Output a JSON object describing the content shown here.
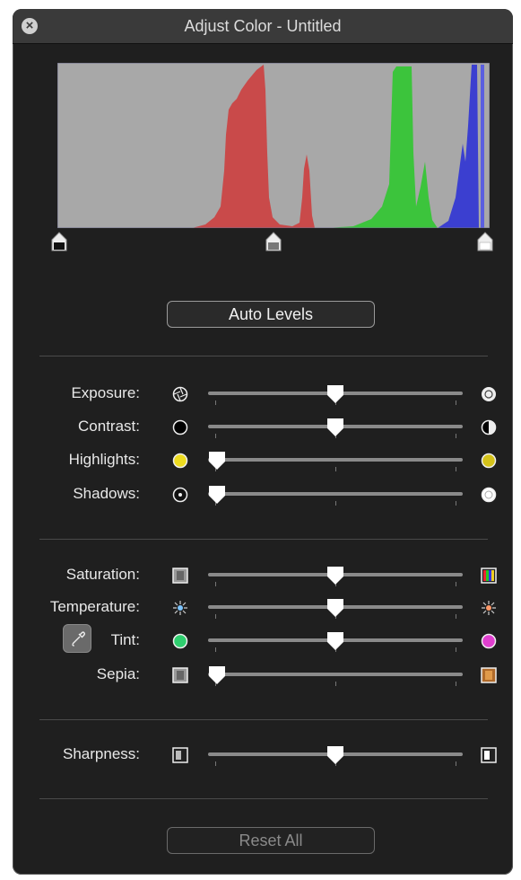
{
  "window": {
    "title": "Adjust Color - Untitled"
  },
  "colors": {
    "panel_bg": "#1f1f1f",
    "histogram_bg": "#a8a8a8",
    "red": "#c94a4a",
    "green": "#3cc43c",
    "blue": "#3b3fd0",
    "track": "#8a8a8a"
  },
  "histogram": {
    "black_point": 0,
    "gamma_point": 0.5,
    "white_point": 1
  },
  "auto_levels": {
    "label": "Auto Levels"
  },
  "sliders": {
    "exposure": {
      "label": "Exposure:",
      "value": 0.5,
      "min_icon": "aperture-icon",
      "max_icon": "aperture-bright-icon"
    },
    "contrast": {
      "label": "Contrast:",
      "value": 0.5,
      "min_icon": "circle-dark-icon",
      "max_icon": "half-circle-icon"
    },
    "highlights": {
      "label": "Highlights:",
      "value": 0.0,
      "min_icon": "yellow-circle-icon",
      "max_icon": "yellow-circle-icon"
    },
    "shadows": {
      "label": "Shadows:",
      "value": 0.0,
      "min_icon": "dot-circle-icon",
      "max_icon": "white-circle-icon"
    },
    "saturation": {
      "label": "Saturation:",
      "value": 0.5,
      "min_icon": "gray-square-icon",
      "max_icon": "color-square-icon"
    },
    "temperature": {
      "label": "Temperature:",
      "value": 0.5,
      "min_icon": "cool-sun-icon",
      "max_icon": "warm-sun-icon"
    },
    "tint": {
      "label": "Tint:",
      "value": 0.5,
      "min_icon": "green-circle-icon",
      "max_icon": "magenta-circle-icon"
    },
    "sepia": {
      "label": "Sepia:",
      "value": 0.0,
      "min_icon": "gray-square-icon",
      "max_icon": "sepia-square-icon"
    },
    "sharpness": {
      "label": "Sharpness:",
      "value": 0.5,
      "min_icon": "soft-square-icon",
      "max_icon": "sharp-square-icon"
    }
  },
  "reset_all": {
    "label": "Reset All"
  }
}
